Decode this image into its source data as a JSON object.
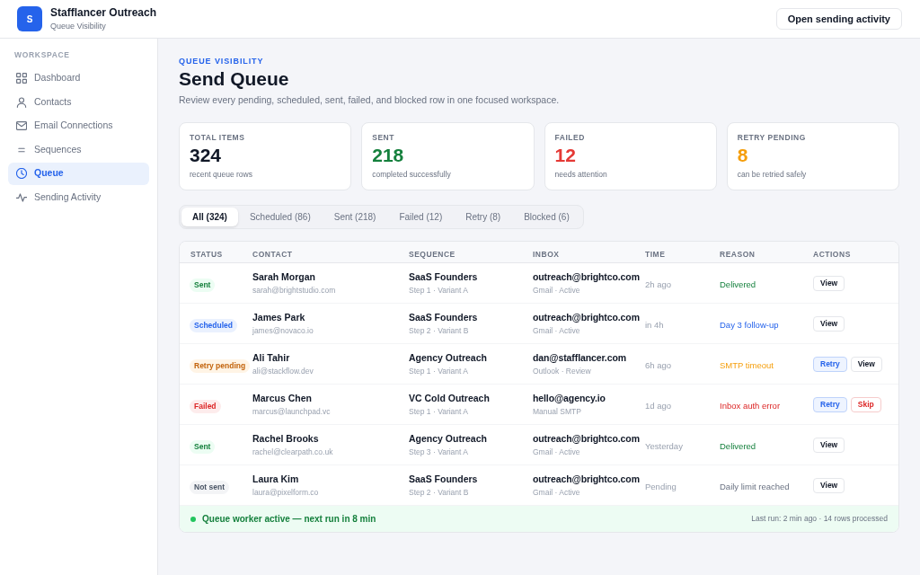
{
  "header": {
    "logo_letter": "S",
    "title": "Stafflancer Outreach",
    "subtitle": "Queue Visibility",
    "button": "Open sending activity"
  },
  "sidebar": {
    "heading": "WORKSPACE",
    "items": [
      {
        "label": "Dashboard",
        "kind": "dashboard",
        "selected": false
      },
      {
        "label": "Contacts",
        "kind": "contacts",
        "selected": false
      },
      {
        "label": "Email Connections",
        "kind": "email",
        "selected": false
      },
      {
        "label": "Sequences",
        "kind": "sequences",
        "selected": false
      },
      {
        "label": "Queue",
        "kind": "queue",
        "selected": true
      },
      {
        "label": "Sending Activity",
        "kind": "activity",
        "selected": false
      }
    ]
  },
  "page": {
    "eyebrow": "QUEUE VISIBILITY",
    "title": "Send Queue",
    "description": "Review every pending, scheduled, sent, failed, and blocked row in one focused workspace."
  },
  "stats": [
    {
      "label": "TOTAL ITEMS",
      "value": "324",
      "note": "recent queue rows",
      "color": "#111827"
    },
    {
      "label": "SENT",
      "value": "218",
      "note": "completed successfully",
      "color": "#15803d"
    },
    {
      "label": "FAILED",
      "value": "12",
      "note": "needs attention",
      "color": "#e53935"
    },
    {
      "label": "RETRY PENDING",
      "value": "8",
      "note": "can be retried safely",
      "color": "#f59e0b"
    }
  ],
  "tabs": [
    {
      "label": "All (324)",
      "selected": true
    },
    {
      "label": "Scheduled (86)",
      "selected": false
    },
    {
      "label": "Sent (218)",
      "selected": false
    },
    {
      "label": "Failed (12)",
      "selected": false
    },
    {
      "label": "Retry (8)",
      "selected": false
    },
    {
      "label": "Blocked (6)",
      "selected": false
    }
  ],
  "table": {
    "columns": [
      "STATUS",
      "CONTACT",
      "SEQUENCE",
      "INBOX",
      "TIME",
      "REASON",
      "ACTIONS"
    ],
    "rows": [
      {
        "status": "Sent",
        "kind": "sent",
        "contact": {
          "name": "Sarah Morgan",
          "email": "sarah@brightstudio.com"
        },
        "sequence": {
          "name": "SaaS Founders",
          "step": "Step 1 · Variant A"
        },
        "inbox": {
          "address": "outreach@brightco.com",
          "detail": "Gmail · Active"
        },
        "time": "2h ago",
        "reason": "Delivered",
        "actions": [
          {
            "label": "View",
            "kind": "view"
          }
        ]
      },
      {
        "status": "Scheduled",
        "kind": "scheduled",
        "contact": {
          "name": "James Park",
          "email": "james@novaco.io"
        },
        "sequence": {
          "name": "SaaS Founders",
          "step": "Step 2 · Variant B"
        },
        "inbox": {
          "address": "outreach@brightco.com",
          "detail": "Gmail · Active"
        },
        "time": "in 4h",
        "reason": "Day 3 follow-up",
        "actions": [
          {
            "label": "View",
            "kind": "view"
          }
        ]
      },
      {
        "status": "Retry pending",
        "kind": "retry",
        "contact": {
          "name": "Ali Tahir",
          "email": "ali@stackflow.dev"
        },
        "sequence": {
          "name": "Agency Outreach",
          "step": "Step 1 · Variant A"
        },
        "inbox": {
          "address": "dan@stafflancer.com",
          "detail": "Outlook · Review"
        },
        "time": "6h ago",
        "reason": "SMTP timeout",
        "actions": [
          {
            "label": "Retry",
            "kind": "retry"
          },
          {
            "label": "View",
            "kind": "view"
          }
        ]
      },
      {
        "status": "Failed",
        "kind": "failed",
        "contact": {
          "name": "Marcus Chen",
          "email": "marcus@launchpad.vc"
        },
        "sequence": {
          "name": "VC Cold Outreach",
          "step": "Step 1 · Variant A"
        },
        "inbox": {
          "address": "hello@agency.io",
          "detail": "Manual SMTP"
        },
        "time": "1d ago",
        "reason": "Inbox auth error",
        "actions": [
          {
            "label": "Retry",
            "kind": "retry"
          },
          {
            "label": "Skip",
            "kind": "skip"
          }
        ]
      },
      {
        "status": "Sent",
        "kind": "sent",
        "contact": {
          "name": "Rachel Brooks",
          "email": "rachel@clearpath.co.uk"
        },
        "sequence": {
          "name": "Agency Outreach",
          "step": "Step 3 · Variant A"
        },
        "inbox": {
          "address": "outreach@brightco.com",
          "detail": "Gmail · Active"
        },
        "time": "Yesterday",
        "reason": "Delivered",
        "actions": [
          {
            "label": "View",
            "kind": "view"
          }
        ]
      },
      {
        "status": "Not sent",
        "kind": "not_sent",
        "contact": {
          "name": "Laura Kim",
          "email": "laura@pixelform.co"
        },
        "sequence": {
          "name": "SaaS Founders",
          "step": "Step 2 · Variant B"
        },
        "inbox": {
          "address": "outreach@brightco.com",
          "detail": "Gmail · Active"
        },
        "time": "Pending",
        "reason": "Daily limit reached",
        "actions": [
          {
            "label": "View",
            "kind": "view"
          }
        ]
      }
    ]
  },
  "status_bar": {
    "message": "Queue worker active — next run in 8 min",
    "active": true,
    "last_run": "Last run: 2 min ago · 14 rows processed"
  }
}
